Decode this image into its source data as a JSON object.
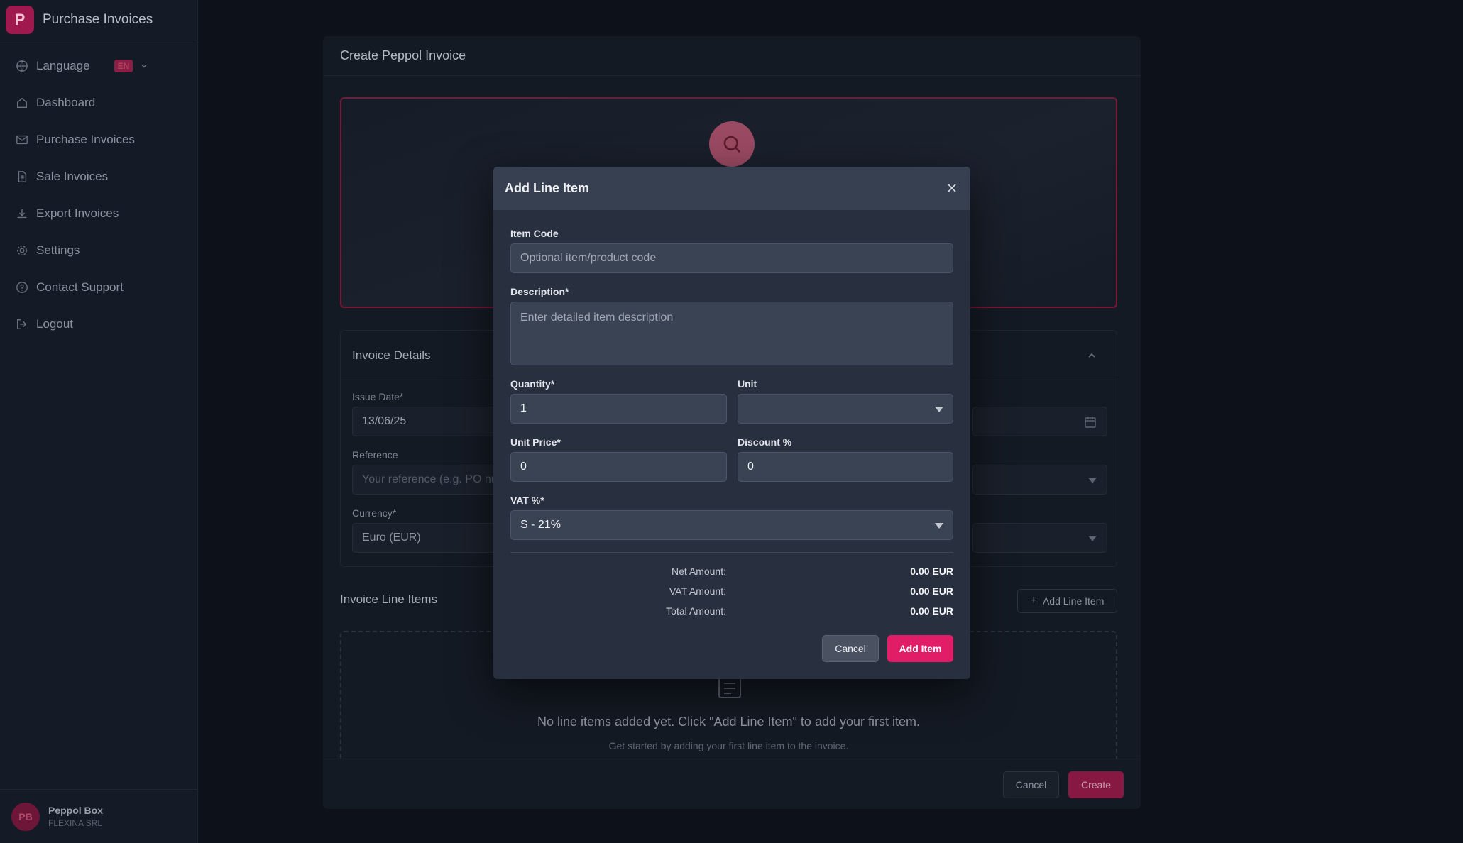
{
  "sidebar": {
    "logo_letter": "P",
    "title": "Purchase Invoices",
    "language": {
      "label": "Language",
      "badge": "EN"
    },
    "items": [
      {
        "label": "Dashboard",
        "icon": "home-icon"
      },
      {
        "label": "Purchase Invoices",
        "icon": "mail-icon"
      },
      {
        "label": "Sale Invoices",
        "icon": "document-icon"
      },
      {
        "label": "Export Invoices",
        "icon": "download-icon"
      },
      {
        "label": "Settings",
        "icon": "gear-icon"
      },
      {
        "label": "Contact Support",
        "icon": "help-circle-icon"
      },
      {
        "label": "Logout",
        "icon": "logout-icon"
      }
    ],
    "user": {
      "initials": "PB",
      "name": "Peppol Box",
      "company": "FLEXINA SRL"
    }
  },
  "panel": {
    "title": "Create Peppol Invoice",
    "details": {
      "title": "Invoice Details",
      "issue_date_label": "Issue Date*",
      "issue_date_value": "13/06/25",
      "reference_label": "Reference",
      "reference_placeholder": "Your reference (e.g. PO nu",
      "currency_label": "Currency*",
      "currency_value": "Euro (EUR)"
    },
    "line_items": {
      "title": "Invoice Line Items",
      "add_button": "Add Line Item",
      "empty_title": "No line items added yet. Click \"Add Line Item\" to add your first item.",
      "empty_sub": "Get started by adding your first line item to the invoice."
    },
    "footer": {
      "cancel": "Cancel",
      "create": "Create"
    }
  },
  "modal": {
    "title": "Add Line Item",
    "item_code": {
      "label": "Item Code",
      "placeholder": "Optional item/product code"
    },
    "description": {
      "label": "Description*",
      "placeholder": "Enter detailed item description"
    },
    "quantity": {
      "label": "Quantity*",
      "value": "1"
    },
    "unit": {
      "label": "Unit",
      "value": ""
    },
    "unit_price": {
      "label": "Unit Price*",
      "value": "0"
    },
    "discount": {
      "label": "Discount %",
      "value": "0"
    },
    "vat": {
      "label": "VAT %*",
      "value": "S - 21%"
    },
    "summary": {
      "net_label": "Net Amount:",
      "net_value": "0.00 EUR",
      "vat_label": "VAT Amount:",
      "vat_value": "0.00 EUR",
      "total_label": "Total Amount:",
      "total_value": "0.00 EUR"
    },
    "cancel": "Cancel",
    "add": "Add Item"
  },
  "colors": {
    "accent": "#e11d67",
    "accent_dim": "#861841",
    "modal_bg": "#283040"
  }
}
